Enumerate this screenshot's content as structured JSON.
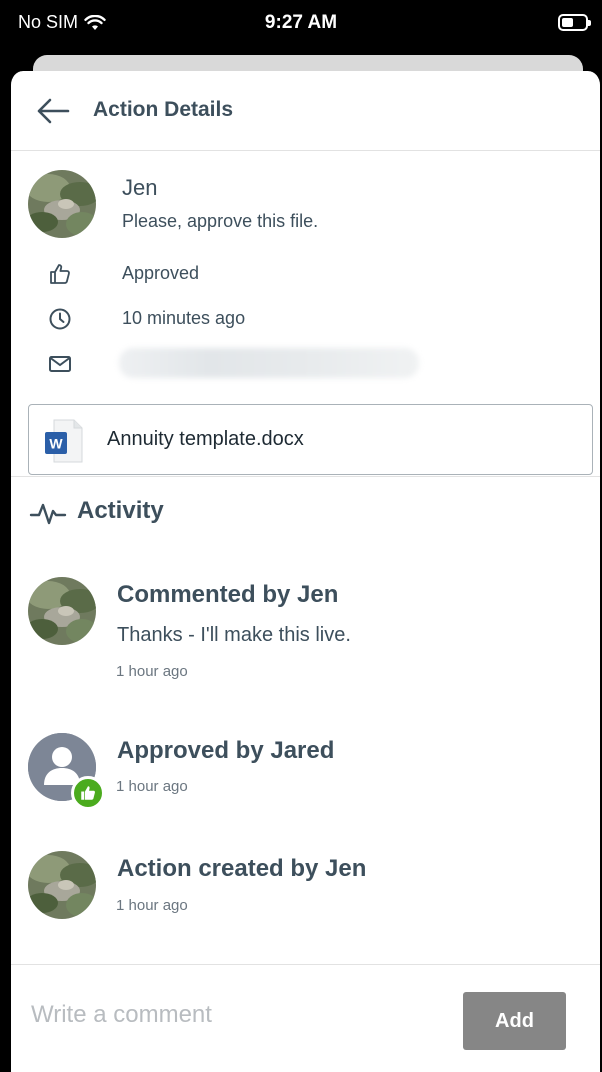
{
  "status_bar": {
    "carrier": "No SIM",
    "time": "9:27 AM"
  },
  "header": {
    "title": "Action Details"
  },
  "action": {
    "sender_name": "Jen",
    "message": "Please, approve this file.",
    "status": "Approved",
    "time_ago": "10 minutes ago",
    "file": {
      "name": "Annuity template.docx",
      "type_icon": "word-doc-icon",
      "icon_letter": "W"
    }
  },
  "activity": {
    "title": "Activity",
    "items": [
      {
        "title": "Commented by Jen",
        "body": "Thanks - I'll make this live.",
        "time": "1 hour ago"
      },
      {
        "title": "Approved by Jared",
        "time": "1 hour ago"
      },
      {
        "title": "Action created by Jen",
        "time": "1 hour ago"
      }
    ]
  },
  "comment": {
    "placeholder": "Write a comment",
    "add_label": "Add"
  },
  "colors": {
    "text": "#3d4f5c",
    "add_button": "#868686",
    "approved_badge": "#4bab1e",
    "word_blue": "#2b5fa8"
  }
}
